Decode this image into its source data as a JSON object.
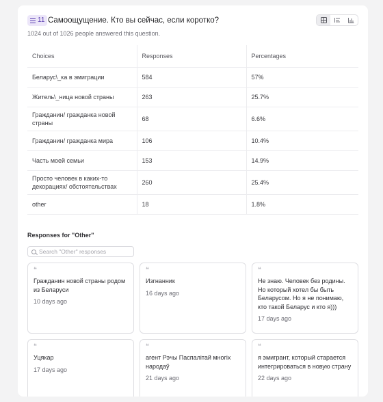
{
  "question": {
    "badge": "11",
    "title": "Самоощущение. Кто вы сейчас, если коротко?",
    "answered_text": "1024 out of 1026 people answered this question."
  },
  "view_switch": [
    "table-view",
    "list-view",
    "bar-chart-view"
  ],
  "table": {
    "headers": [
      "Choices",
      "Responses",
      "Percentages"
    ],
    "rows": [
      {
        "choice": "Беларус\\_ка в эмиграции",
        "responses": "584",
        "pct": "57%"
      },
      {
        "choice": "Житель\\_ница новой страны",
        "responses": "263",
        "pct": "25.7%"
      },
      {
        "choice": "Гражданин/ гражданка новой страны",
        "responses": "68",
        "pct": "6.6%"
      },
      {
        "choice": "Гражданин/ гражданка мира",
        "responses": "106",
        "pct": "10.4%"
      },
      {
        "choice": "Часть моей семьи",
        "responses": "153",
        "pct": "14.9%"
      },
      {
        "choice": "Просто человек в каких-то декорациях/ обстоятельствах",
        "responses": "260",
        "pct": "25.4%"
      },
      {
        "choice": "other",
        "responses": "18",
        "pct": "1.8%"
      }
    ]
  },
  "other_section": {
    "title": "Responses for \"Other\"",
    "search_placeholder": "Search \"Other\" responses",
    "responses": [
      {
        "text": "Гражданин новой страны родом из Беларуси",
        "ago": "10 days ago"
      },
      {
        "text": "Изгнанник",
        "ago": "16 days ago"
      },
      {
        "text": "Не знаю. Человек без родины. Но который хотел бы быть Беларусом. Но я не понимаю, кто такой Беларус и кто я)))",
        "ago": "17 days ago"
      },
      {
        "text": "Уцякар",
        "ago": "17 days ago"
      },
      {
        "text": "агент Рэчы Паспалітай многіх народаў",
        "ago": "21 days ago"
      },
      {
        "text": "я эмигрант, который старается интегрироваться в новую страну",
        "ago": "22 days ago"
      }
    ]
  },
  "colors": {
    "accent": "#5b3fb0",
    "badge_bg": "#ece6f9",
    "border": "#ececef",
    "page_bg": "#f3f3f4"
  }
}
